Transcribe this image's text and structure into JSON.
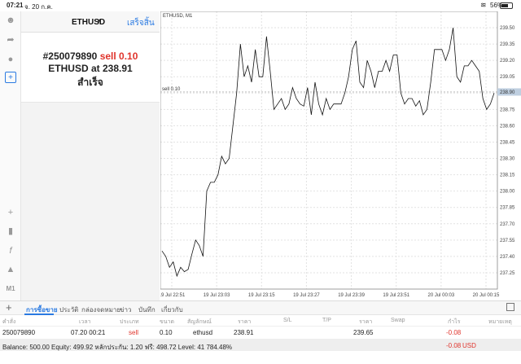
{
  "status": {
    "time": "07:21",
    "date": "จ. 20 ก.ค.",
    "battery": "56%",
    "wifi_icon": "wifi-icon"
  },
  "toolbar_icons": [
    "user-icon",
    "share-icon",
    "chat-icon",
    "add-document-icon",
    "crosshair-icon",
    "candles-icon",
    "function-icon",
    "objects-icon"
  ],
  "toolbar_timeframe": "M1",
  "panel": {
    "symbol": "ETHUSD",
    "done_label": "เสร็จสิ้น",
    "order_id": "#250079890",
    "order_side": "sell 0.10",
    "order_at": "ETHUSD at",
    "order_price": "238.91",
    "order_status": "สำเร็จ"
  },
  "chart_data": {
    "type": "line",
    "title": "ETHUSD, M1",
    "ylim": [
      237.1,
      239.65
    ],
    "y_ticks": [
      "239.50",
      "239.35",
      "239.20",
      "239.05",
      "238.90",
      "238.75",
      "238.60",
      "238.45",
      "238.30",
      "238.15",
      "238.00",
      "237.85",
      "237.70",
      "237.55",
      "237.40",
      "237.25"
    ],
    "x_ticks": [
      "19 Jul 22:51",
      "19 Jul 23:03",
      "19 Jul 23:15",
      "19 Jul 23:27",
      "19 Jul 23:39",
      "19 Jul 23:51",
      "20 Jul 00:03",
      "20 Jul 00:15"
    ],
    "order_line": {
      "label": "sell 0.10",
      "price": 238.91,
      "price_label": "238.90"
    },
    "values": [
      237.45,
      237.4,
      237.3,
      237.35,
      237.22,
      237.3,
      237.26,
      237.28,
      237.42,
      237.55,
      237.5,
      237.4,
      238.0,
      238.08,
      238.08,
      238.15,
      238.32,
      238.25,
      238.3,
      238.6,
      238.9,
      239.35,
      239.05,
      239.15,
      239.0,
      239.3,
      239.05,
      239.05,
      239.42,
      239.1,
      238.75,
      238.8,
      238.85,
      238.75,
      238.8,
      238.95,
      238.85,
      238.8,
      238.78,
      238.95,
      238.7,
      239.0,
      238.8,
      238.7,
      238.85,
      238.75,
      238.8,
      238.8,
      238.8,
      238.9,
      239.05,
      239.3,
      239.38,
      239.0,
      238.95,
      239.2,
      239.1,
      238.95,
      239.1,
      239.1,
      239.2,
      239.1,
      239.25,
      239.25,
      238.9,
      238.8,
      238.85,
      238.85,
      238.78,
      238.83,
      238.7,
      238.75,
      239.0,
      239.3,
      239.3,
      239.3,
      239.2,
      239.3,
      239.5,
      239.05,
      239.0,
      239.15,
      239.15,
      239.2,
      239.15,
      239.1,
      238.85,
      238.75,
      238.8,
      238.9
    ]
  },
  "tabs": {
    "items": [
      "การซื้อขาย",
      "ประวัติ",
      "กล่องจดหมาย",
      "ข่าว",
      "บันทึก",
      "เกี่ยวกับ"
    ],
    "active": 0
  },
  "columns": [
    "คำสั่ง",
    "เวลา",
    "ประเภท",
    "ขนาด",
    "สัญลักษณ์",
    "ราคา",
    "S/L",
    "T/P",
    "ราคา",
    "Swap",
    "กำไร",
    "หมายเหตุ"
  ],
  "order": {
    "id": "250079890",
    "time": "07.20 00:21",
    "type": "sell",
    "size": "0.10",
    "symbol": "ethusd",
    "price": "238.91",
    "sl": "",
    "tp": "",
    "current": "239.65",
    "swap": "",
    "profit": "-0.08",
    "comment": ""
  },
  "balance": {
    "text": "Balance: 500.00 Equity: 499.92 หลักประกัน: 1.20 ฟรี: 498.72 Level: 41 784.48%",
    "profit": "-0.08",
    "currency": "USD"
  }
}
